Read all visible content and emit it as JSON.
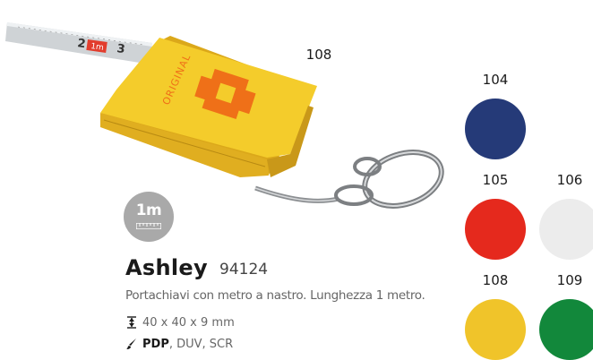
{
  "product": {
    "name": "Ashley",
    "code": "94124",
    "description": "Portachiavi con metro a nastro. Lunghezza 1 metro.",
    "dimensions": "40 x 40 x 9 mm",
    "print_primary": "PDP",
    "print_rest": ", DUV, SCR",
    "tape_length_badge": "1m",
    "image_variant_code": "108",
    "image_brand_text": "ORIGINAL",
    "tape_marks": [
      "2",
      "3",
      "1m",
      "3"
    ]
  },
  "variants": [
    {
      "code": "104",
      "color": "#253a78"
    },
    {
      "code": "105",
      "color": "#e5291d"
    },
    {
      "code": "106",
      "color": "#ececec"
    },
    {
      "code": "108",
      "color": "#f0c42a"
    },
    {
      "code": "109",
      "color": "#12883b"
    }
  ],
  "icons": {
    "badge": "tape-measure-1m-icon",
    "dimensions": "vertical-dimension-arrow-icon",
    "print": "print-brush-icon"
  }
}
